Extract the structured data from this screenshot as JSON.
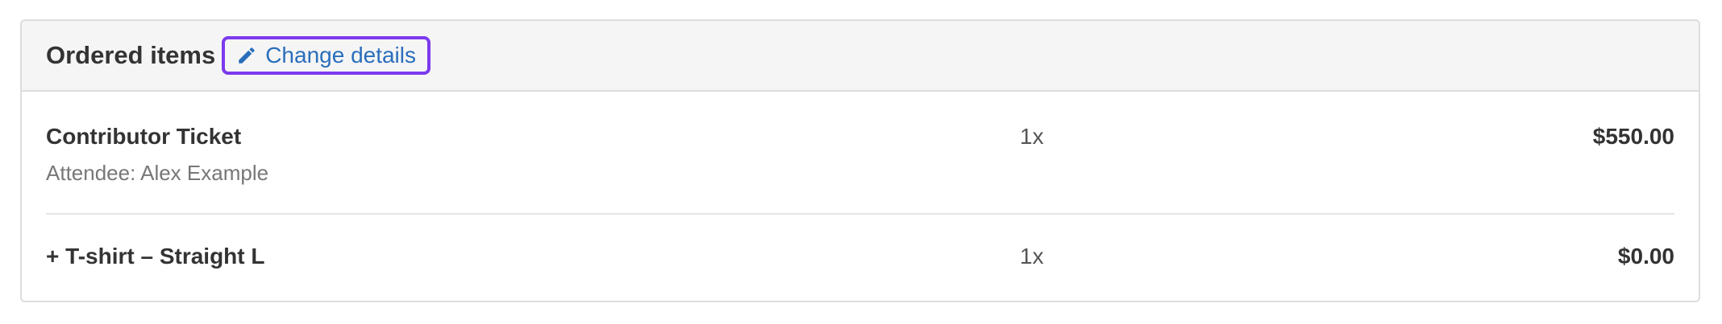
{
  "panel": {
    "title": "Ordered items",
    "change_link_label": "Change details"
  },
  "items": [
    {
      "name": "Contributor Ticket",
      "detail": "Attendee: Alex Example",
      "quantity": "1x",
      "price": "$550.00"
    },
    {
      "name": "+ T-shirt – Straight L",
      "quantity": "1x",
      "price": "$0.00"
    }
  ],
  "colors": {
    "link": "#2a6ebb",
    "focus_outline": "#7c3aed",
    "heading_bg": "#f5f5f5",
    "border": "#dddddd"
  },
  "icons": {
    "change_link_icon": "pencil-icon"
  }
}
